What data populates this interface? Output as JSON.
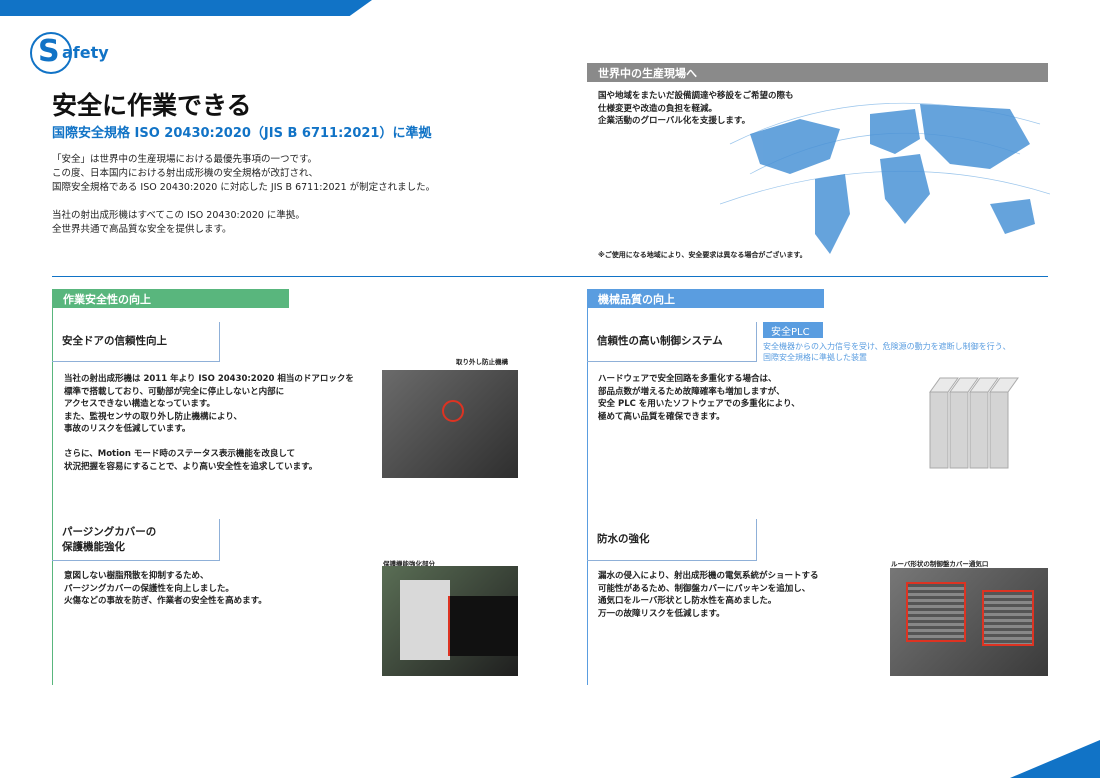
{
  "logo": {
    "letter": "S",
    "text": "afety"
  },
  "title": "安全に作業できる",
  "subtitle": "国際安全規格 ISO 20430:2020（JIS B 6711:2021）に準拠",
  "intro": {
    "p1": "「安全」は世界中の生産現場における最優先事項の一つです。\nこの度、日本国内における射出成形機の安全規格が改訂され、\n国際安全規格である ISO 20430:2020 に対応した JIS B 6711:2021 が制定されました。",
    "p2": "当社の射出成形機はすべてこの ISO 20430:2020 に準拠。\n全世界共通で高品質な安全を提供します。"
  },
  "world": {
    "header": "世界中の生産現場へ",
    "text": "国や地域をまたいだ設備調達や移設をご希望の際も\n仕様変更や改造の負担を軽減。\n企業活動のグローバル化を支援します。",
    "note": "※ご使用になる地域により、安全要求は異なる場合がございます。"
  },
  "left_section": {
    "header": "作業安全性の向上",
    "item1": {
      "title": "安全ドアの信頼性向上",
      "text": "当社の射出成形機は 2011 年より ISO 20430:2020 相当のドアロックを\n標準で搭載しており、可動部が完全に停止しないと内部に\nアクセスできない構造となっています。\nまた、監視センサの取り外し防止機構により、\n事故のリスクを低減しています。\n\nさらに、Motion モード時のステータス表示機能を改良して\n状況把握を容易にすることで、より高い安全性を追求しています。",
      "callout": "取り外し防止機構"
    },
    "item2": {
      "title": "パージングカバーの\n保護機能強化",
      "text": "意図しない樹脂飛散を抑制するため、\nパージングカバーの保護性を向上しました。\n火傷などの事故を防ぎ、作業者の安全性を高めます。",
      "callout": "保護機能強化部分"
    }
  },
  "right_section": {
    "header": "機械品質の向上",
    "item1": {
      "title": "信頼性の高い制御システム",
      "tag": "安全PLC",
      "tag_desc": "安全機器からの入力信号を受け、危険源の動力を遮断し制御を行う、\n国際安全規格に準拠した装置",
      "text": "ハードウェアで安全回路を多重化する場合は、\n部品点数が増えるため故障確率も増加しますが、\n安全 PLC を用いたソフトウェアでの多重化により、\n極めて高い品質を確保できます。"
    },
    "item2": {
      "title": "防水の強化",
      "text": "漏水の侵入により、射出成形機の電気系統がショートする\n可能性があるため、制御盤カバーにパッキンを追加し、\n通気口をルーバ形状とし防水性を高めました。\n万一の故障リスクを低減します。",
      "callout": "ルーバ形状の制御盤カバー通気口"
    }
  }
}
